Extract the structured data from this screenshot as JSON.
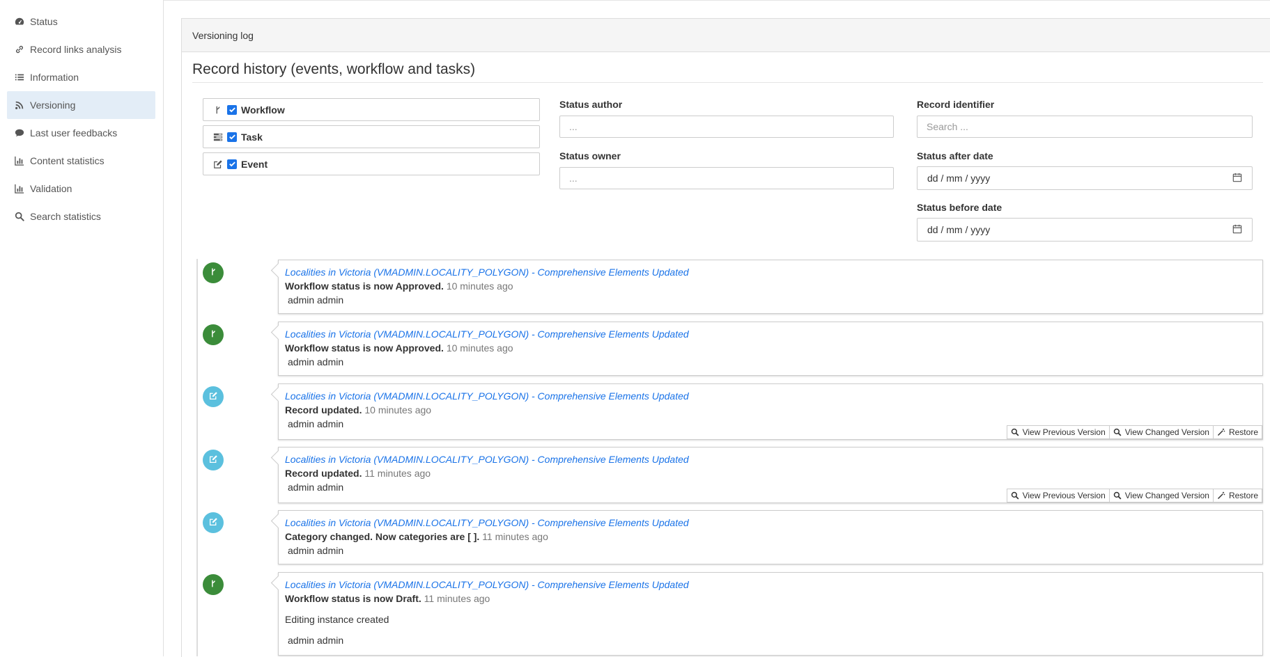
{
  "sidebar": {
    "items": [
      {
        "label": "Status",
        "icon": "dashboard-icon"
      },
      {
        "label": "Record links analysis",
        "icon": "link-icon"
      },
      {
        "label": "Information",
        "icon": "list-icon"
      },
      {
        "label": "Versioning",
        "icon": "rss-icon",
        "active": true
      },
      {
        "label": "Last user feedbacks",
        "icon": "comment-icon"
      },
      {
        "label": "Content statistics",
        "icon": "bar-chart-icon"
      },
      {
        "label": "Validation",
        "icon": "bar-chart-icon"
      },
      {
        "label": "Search statistics",
        "icon": "search-icon"
      }
    ]
  },
  "panel": {
    "heading": "Versioning log",
    "title": "Record history (events, workflow and tasks)"
  },
  "filters": {
    "workflow": "Workflow",
    "task": "Task",
    "event": "Event"
  },
  "fields": {
    "status_author_label": "Status author",
    "status_author_placeholder": "...",
    "status_owner_label": "Status owner",
    "status_owner_placeholder": "...",
    "record_identifier_label": "Record identifier",
    "record_identifier_placeholder": "Search ...",
    "status_after_label": "Status after date",
    "status_after_value": "dd / mm / yyyy",
    "status_before_label": "Status before date",
    "status_before_value": "dd / mm / yyyy"
  },
  "actions": {
    "view_previous": "View Previous Version",
    "view_changed": "View Changed Version",
    "restore": "Restore"
  },
  "colors": {
    "workflow_badge": "#3b8c3a",
    "event_badge": "#5bc0de",
    "link": "#1a73e8"
  },
  "entries": [
    {
      "type": "workflow",
      "title": "Localities in Victoria (VMADMIN.LOCALITY_POLYGON) - Comprehensive Elements Updated",
      "message": "Workflow status is now Approved.",
      "time": "10 minutes ago",
      "user": "admin admin"
    },
    {
      "type": "workflow",
      "title": "Localities in Victoria (VMADMIN.LOCALITY_POLYGON) - Comprehensive Elements Updated",
      "message": "Workflow status is now Approved.",
      "time": "10 minutes ago",
      "user": "admin admin"
    },
    {
      "type": "event",
      "title": "Localities in Victoria (VMADMIN.LOCALITY_POLYGON) - Comprehensive Elements Updated",
      "message": "Record updated.",
      "time": "10 minutes ago",
      "user": "admin admin"
    },
    {
      "type": "event",
      "title": "Localities in Victoria (VMADMIN.LOCALITY_POLYGON) - Comprehensive Elements Updated",
      "message": "Record updated.",
      "time": "11 minutes ago",
      "user": "admin admin"
    },
    {
      "type": "event",
      "title": "Localities in Victoria (VMADMIN.LOCALITY_POLYGON) - Comprehensive Elements Updated",
      "message": "Category changed. Now categories are [ ].",
      "time": "11 minutes ago",
      "user": "admin admin"
    },
    {
      "type": "workflow",
      "title": "Localities in Victoria (VMADMIN.LOCALITY_POLYGON) - Comprehensive Elements Updated",
      "message": "Workflow status is now Draft.",
      "time": "11 minutes ago",
      "extra": "Editing instance created",
      "user": "admin admin"
    }
  ]
}
